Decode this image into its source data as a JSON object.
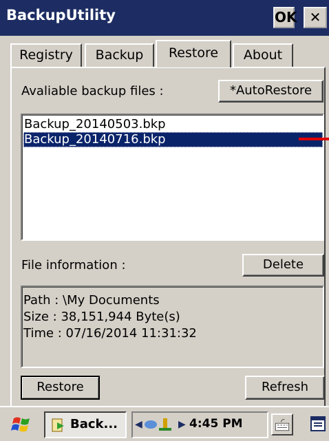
{
  "window": {
    "title": "BackupUtility",
    "ok_label": "OK",
    "close_label": "✕"
  },
  "tabs": [
    {
      "label": "Registry",
      "active": false
    },
    {
      "label": "Backup",
      "active": false
    },
    {
      "label": "Restore",
      "active": true
    },
    {
      "label": "About",
      "active": false
    }
  ],
  "restore": {
    "available_label": "Avaliable backup files :",
    "autorestore_label": "*AutoRestore",
    "files": [
      {
        "name": "Backup_20140503.bkp",
        "selected": false
      },
      {
        "name": "Backup_20140716.bkp",
        "selected": true
      }
    ],
    "fileinfo_label": "File information :",
    "delete_label": "Delete",
    "info": {
      "path": "Path : \\My Documents",
      "size": "Size : 38,151,944 Byte(s)",
      "time": "Time : 07/16/2014 11:31:32"
    },
    "restore_label": "Restore",
    "refresh_label": "Refresh"
  },
  "taskbar": {
    "task_label": "Back...",
    "clock": "4:45 PM",
    "tray_left_arrow": "◀",
    "tray_right_arrow": "▶"
  },
  "colors": {
    "titlebar": "#1d2d63",
    "window_face": "#d4d0c8",
    "selection": "#0a246a",
    "annotation_arrow": "#e00000"
  }
}
